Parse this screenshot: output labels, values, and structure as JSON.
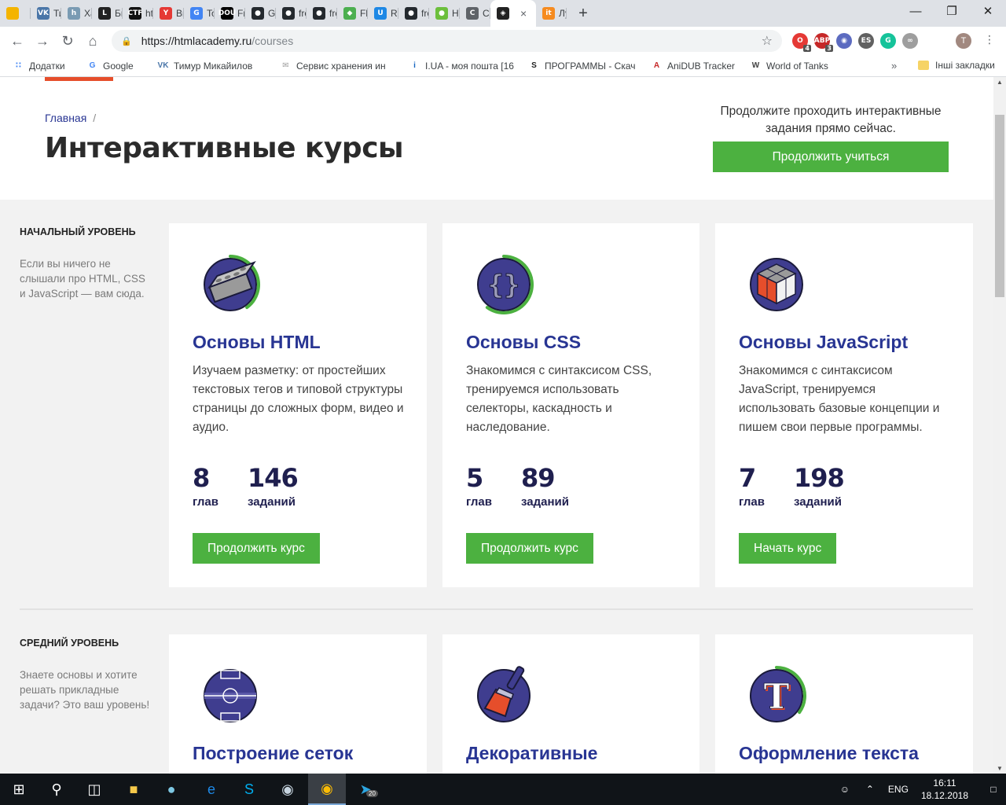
{
  "browser": {
    "tabs": [
      {
        "title": "",
        "color": "#f4b400",
        "glyph": ""
      },
      {
        "title": "Тим",
        "color": "#4a76a8",
        "glyph": "VK"
      },
      {
        "title": "Хаб",
        "color": "#7a9bb3",
        "glyph": "h"
      },
      {
        "title": "Быс",
        "color": "#222222",
        "glyph": "L"
      },
      {
        "title": "http",
        "color": "#111111",
        "glyph": "CTF"
      },
      {
        "title": "Вне",
        "color": "#e53935",
        "glyph": "Y"
      },
      {
        "title": "Tow",
        "color": "#4285f4",
        "glyph": "G"
      },
      {
        "title": "Free",
        "color": "#000000",
        "glyph": "DOU"
      },
      {
        "title": "Git",
        "color": "#24292e",
        "glyph": "●"
      },
      {
        "title": "fror",
        "color": "#24292e",
        "glyph": "●"
      },
      {
        "title": "fror",
        "color": "#24292e",
        "glyph": "●"
      },
      {
        "title": "Flex",
        "color": "#4caf50",
        "glyph": "◆"
      },
      {
        "title": "Res",
        "color": "#1e88e5",
        "glyph": "U"
      },
      {
        "title": "fror",
        "color": "#24292e",
        "glyph": "●"
      },
      {
        "title": "HTT",
        "color": "#6cbf3c",
        "glyph": "●"
      },
      {
        "title": "Cor",
        "color": "#5f6368",
        "glyph": "C"
      }
    ],
    "active_tab": {
      "title": "",
      "color": "#222222",
      "glyph": "◈"
    },
    "after_tabs": [
      {
        "title": "Луч",
        "color": "#f68b1f",
        "glyph": "it"
      }
    ],
    "url_host": "https://htmlacademy.ru",
    "url_path": "/courses",
    "extensions": [
      {
        "name": "opera-ext",
        "color": "#e53935",
        "glyph": "O",
        "badge": "4"
      },
      {
        "name": "adblock-ext",
        "color": "#c62828",
        "glyph": "ABP",
        "badge": "3"
      },
      {
        "name": "owl-ext",
        "color": "#5c6bc0",
        "glyph": "◉",
        "badge": ""
      },
      {
        "name": "es-ext",
        "color": "#616161",
        "glyph": "ES",
        "badge": ""
      },
      {
        "name": "grammarly-ext",
        "color": "#15c39a",
        "glyph": "G",
        "badge": ""
      },
      {
        "name": "link-ext",
        "color": "#9e9e9e",
        "glyph": "∞",
        "badge": ""
      }
    ],
    "profile_initial": "T",
    "bookmarks": [
      {
        "label": "Додатки",
        "icon": "apps",
        "color": "#4285f4"
      },
      {
        "label": "Google",
        "icon": "G",
        "color": "#4285f4"
      },
      {
        "label": "Тимур Микайилов",
        "icon": "VK",
        "color": "#4a76a8"
      },
      {
        "label": "Сервис хранения ин",
        "icon": "✉",
        "color": "#9e9e9e"
      },
      {
        "label": "I.UA - моя пошта [16",
        "icon": "i",
        "color": "#1565c0"
      },
      {
        "label": "ПРОГРАММЫ - Скач",
        "icon": "S",
        "color": "#222222"
      },
      {
        "label": "AniDUB Tracker",
        "icon": "A",
        "color": "#c62828"
      },
      {
        "label": "World of Tanks",
        "icon": "W",
        "color": "#424242"
      }
    ],
    "other_bookmarks": "Інші закладки"
  },
  "hero": {
    "breadcrumb": "Главная",
    "breadcrumb_sep": "/",
    "title": "Интерактивные курсы",
    "cta_text": "Продолжите проходить интерактивные задания прямо сейчас.",
    "cta_button": "Продолжить учиться"
  },
  "levels": [
    {
      "title": "Начальный уровень",
      "description": "Если вы ничего не слышали про HTML, CSS и JavaScript — вам сюда.",
      "courses": [
        {
          "title": "Основы HTML",
          "description": "Изучаем разметку: от простейших текстовых тегов и типовой структуры страницы до сложных форм, видео и аудио.",
          "chapters": "8",
          "chapters_label": "глав",
          "tasks": "146",
          "tasks_label": "заданий",
          "button": "Продолжить курс",
          "progress": 0.4
        },
        {
          "title": "Основы CSS",
          "description": "Знакомимся с синтаксисом CSS, тренируемся использовать селекторы, каскадность и наследование.",
          "chapters": "5",
          "chapters_label": "глав",
          "tasks": "89",
          "tasks_label": "заданий",
          "button": "Продолжить курс",
          "progress": 0.6
        },
        {
          "title": "Основы JavaScript",
          "description": "Знакомимся с синтаксисом JavaScript, тренируемся использовать базовые концепции и пишем свои первые программы.",
          "chapters": "7",
          "chapters_label": "глав",
          "tasks": "198",
          "tasks_label": "заданий",
          "button": "Начать курс",
          "progress": 0
        }
      ]
    },
    {
      "title": "Средний уровень",
      "description": "Знаете основы и хотите решать прикладные задачи? Это ваш уровень!",
      "courses": [
        {
          "title": "Построение сеток",
          "progress": 0
        },
        {
          "title": "Декоративные",
          "progress": 0
        },
        {
          "title": "Оформление текста",
          "progress": 0.35
        }
      ]
    }
  ],
  "taskbar": {
    "lang": "ENG",
    "time": "16:11",
    "date": "18.12.2018",
    "telegram_badge": "20"
  },
  "colors": {
    "accent_green": "#4cb140",
    "title_blue": "#283593",
    "orange": "#e64e2b"
  }
}
